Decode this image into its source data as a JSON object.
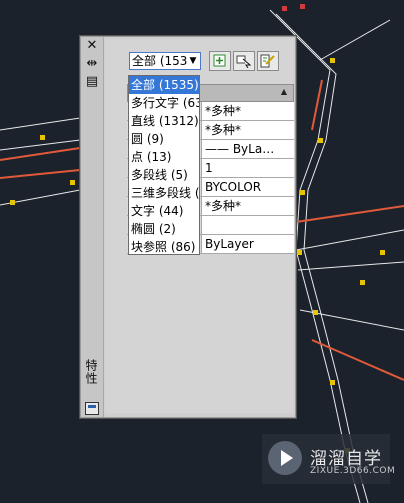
{
  "palette": {
    "title": "特性",
    "selector_value": "全部 (153",
    "grid_rows": [
      "*多种*",
      "*多种*",
      "—— ByLa…",
      "1",
      "BYCOLOR",
      "*多种*",
      "",
      "ByLayer"
    ],
    "dropdown_options": [
      "全部 (1535)",
      "多行文字 (63",
      "直线 (1312)",
      "圆 (9)",
      "点 (13)",
      "多段线 (5)",
      "三维多段线 (",
      "文字 (44)",
      "椭圆 (2)",
      "块参照 (86)"
    ],
    "selected_option_index": 0
  },
  "watermark": {
    "name": "溜溜自学",
    "url": "ZIXUE.3D66.COM"
  },
  "colors": {
    "canvas_bg": "#1b222c",
    "highlight": "#3477d6"
  }
}
